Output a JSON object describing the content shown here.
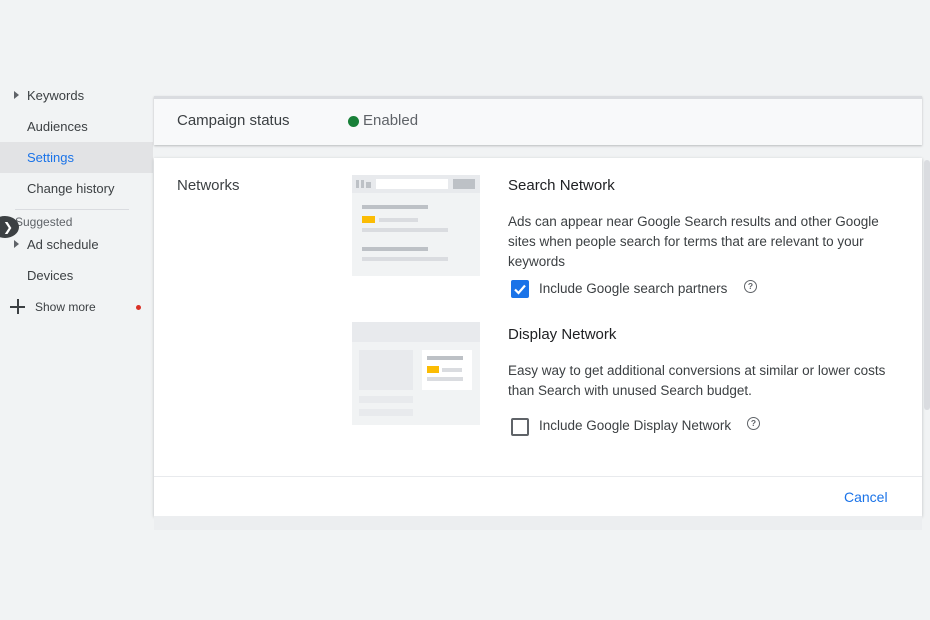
{
  "sidebar": {
    "items": [
      {
        "label": "Keywords",
        "caret": true,
        "active": false
      },
      {
        "label": "Audiences",
        "caret": false,
        "active": false
      },
      {
        "label": "Settings",
        "caret": false,
        "active": true
      },
      {
        "label": "Change history",
        "caret": false,
        "active": false
      }
    ],
    "suggested_label": "Suggested",
    "suggested_items": [
      {
        "label": "Ad schedule",
        "caret": true
      },
      {
        "label": "Devices",
        "caret": false
      }
    ],
    "show_more_label": "Show more"
  },
  "campaign_status": {
    "title": "Campaign status",
    "value": "Enabled",
    "status_color": "#188038"
  },
  "networks": {
    "label": "Networks",
    "search": {
      "title": "Search Network",
      "description": "Ads can appear near Google Search results and other Google sites when people search for terms that are relevant to your keywords",
      "checkbox_label": "Include Google search partners",
      "checked": true
    },
    "display": {
      "title": "Display Network",
      "description": "Easy way to get additional conversions at similar or lower costs than Search with unused Search budget.",
      "checkbox_label": "Include Google Display Network",
      "checked": false
    },
    "help_glyph": "?"
  },
  "actions": {
    "cancel_label": "Cancel"
  },
  "colors": {
    "accent": "#1a73e8",
    "highlight_yellow": "#fbbc04"
  }
}
